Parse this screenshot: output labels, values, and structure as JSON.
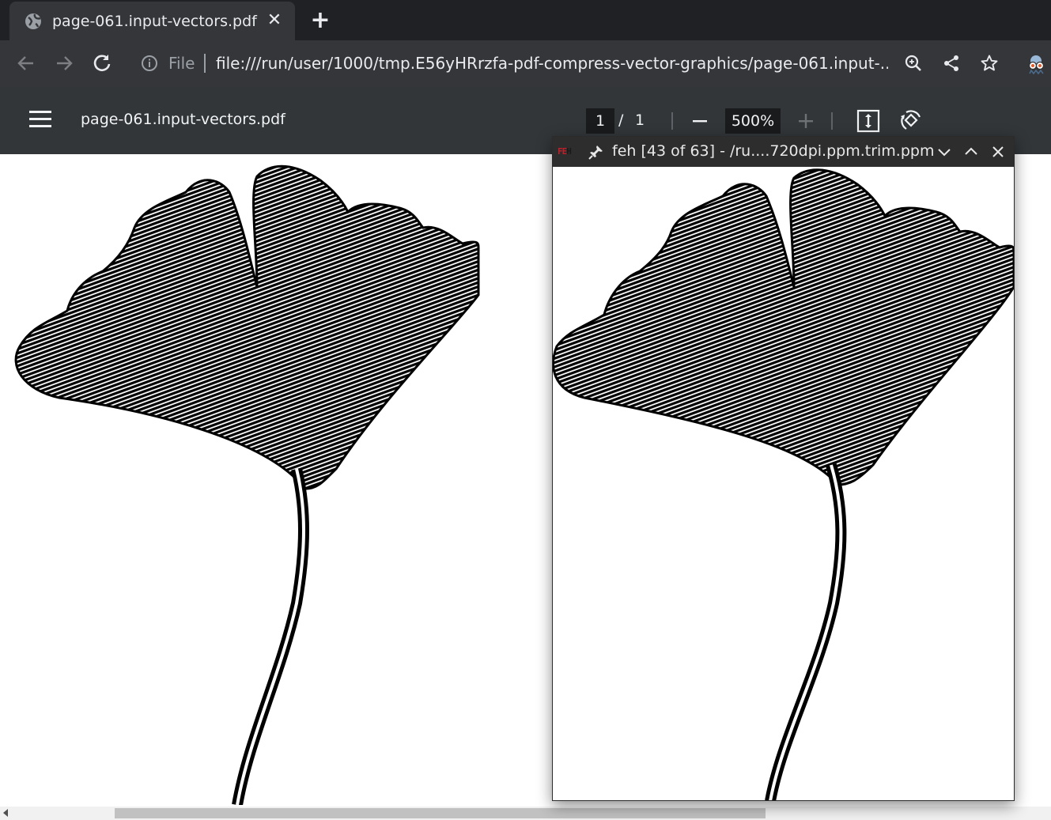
{
  "browser": {
    "tab": {
      "title": "page-061.input-vectors.pdf",
      "favicon": "globe-icon",
      "close": "✕"
    },
    "new_tab": "+",
    "toolbar": {
      "back": "arrow-left-icon",
      "forward": "arrow-right-icon",
      "reload": "reload-icon",
      "security_label": "File",
      "url": "file:///run/user/1000/tmp.E56yHRrzfa-pdf-compress-vector-graphics/page-061.input-...",
      "icons": [
        "zoom-icon",
        "share-icon",
        "bookmark-star-icon",
        "extension-icon"
      ]
    }
  },
  "pdf_viewer": {
    "title": "page-061.input-vectors.pdf",
    "current_page": "1",
    "page_separator": "/",
    "total_pages": "1",
    "zoom": "500%"
  },
  "feh": {
    "logo": "FEH",
    "title": "feh [43 of 63] - /ru....720dpi.ppm.trim.ppm"
  },
  "colors": {
    "tabstrip_bg": "#202124",
    "toolbar_bg": "#35363a",
    "pdfbar_bg": "#323639",
    "feh_titlebar_bg": "#2d2d2d",
    "feh_logo_red": "#c0202a"
  }
}
